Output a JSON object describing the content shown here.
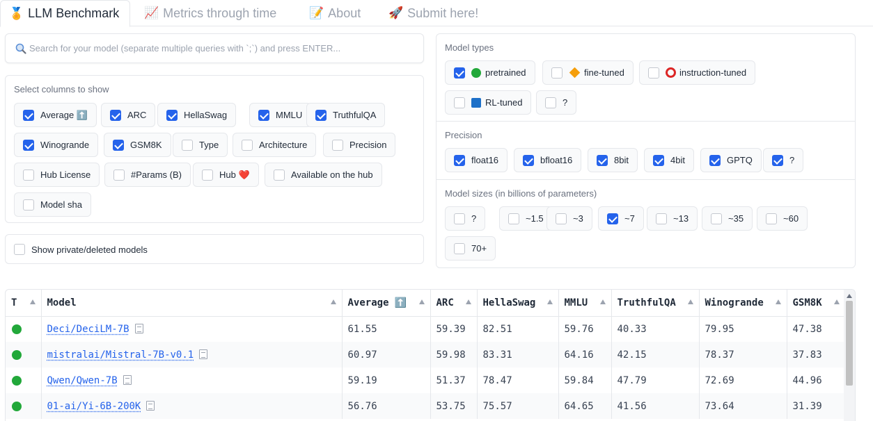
{
  "tabs": [
    {
      "emoji": "🏅",
      "label": "LLM Benchmark"
    },
    {
      "emoji": "📈",
      "label": "Metrics through time"
    },
    {
      "emoji": "📝",
      "label": "About"
    },
    {
      "emoji": "🚀",
      "label": "Submit here!"
    }
  ],
  "search": {
    "placeholder": "Search for your model (separate multiple queries with `;`) and press ENTER..."
  },
  "columns": {
    "label": "Select columns to show",
    "options": [
      {
        "label": "Average ⬆️",
        "checked": true
      },
      {
        "label": "ARC",
        "checked": true
      },
      {
        "label": "HellaSwag",
        "checked": true
      },
      {
        "label": "MMLU",
        "checked": true
      },
      {
        "label": "TruthfulQA",
        "checked": true
      },
      {
        "label": "Winogrande",
        "checked": true
      },
      {
        "label": "GSM8K",
        "checked": true
      },
      {
        "label": "Type",
        "checked": false
      },
      {
        "label": "Architecture",
        "checked": false
      },
      {
        "label": "Precision",
        "checked": false
      },
      {
        "label": "Hub License",
        "checked": false
      },
      {
        "label": "#Params (B)",
        "checked": false
      },
      {
        "label": "Hub ❤️",
        "checked": false
      },
      {
        "label": "Available on the hub",
        "checked": false
      },
      {
        "label": "Model sha",
        "checked": false
      }
    ]
  },
  "private": {
    "label": "Show private/deleted models",
    "checked": false
  },
  "model_types": {
    "label": "Model types",
    "options": [
      {
        "label": "pretrained",
        "checked": true,
        "icon": "green-circle-icon"
      },
      {
        "label": "fine-tuned",
        "checked": false,
        "icon": "orange-diamond-icon"
      },
      {
        "label": "instruction-tuned",
        "checked": false,
        "icon": "red-ring-icon"
      },
      {
        "label": "RL-tuned",
        "checked": false,
        "icon": "blue-square-icon"
      },
      {
        "label": "?",
        "checked": false,
        "icon": ""
      }
    ]
  },
  "precision": {
    "label": "Precision",
    "options": [
      {
        "label": "float16",
        "checked": true
      },
      {
        "label": "bfloat16",
        "checked": true
      },
      {
        "label": "8bit",
        "checked": true
      },
      {
        "label": "4bit",
        "checked": true
      },
      {
        "label": "GPTQ",
        "checked": true
      },
      {
        "label": "?",
        "checked": true
      }
    ]
  },
  "sizes": {
    "label": "Model sizes (in billions of parameters)",
    "options": [
      {
        "label": "?",
        "checked": false
      },
      {
        "label": "~1.5",
        "checked": false
      },
      {
        "label": "~3",
        "checked": false
      },
      {
        "label": "~7",
        "checked": true
      },
      {
        "label": "~13",
        "checked": false
      },
      {
        "label": "~35",
        "checked": false
      },
      {
        "label": "~60",
        "checked": false
      },
      {
        "label": "70+",
        "checked": false
      }
    ]
  },
  "table": {
    "headers": [
      "T",
      "Model",
      "Average ⬆️",
      "ARC",
      "HellaSwag",
      "MMLU",
      "TruthfulQA",
      "Winogrande",
      "GSM8K"
    ],
    "rows": [
      {
        "type": "green-circle-icon",
        "model": "Deci/DeciLM-7B",
        "values": [
          "61.55",
          "59.39",
          "82.51",
          "59.76",
          "40.33",
          "79.95",
          "47.38"
        ]
      },
      {
        "type": "green-circle-icon",
        "model": "mistralai/Mistral-7B-v0.1",
        "values": [
          "60.97",
          "59.98",
          "83.31",
          "64.16",
          "42.15",
          "78.37",
          "37.83"
        ]
      },
      {
        "type": "green-circle-icon",
        "model": "Qwen/Qwen-7B",
        "values": [
          "59.19",
          "51.37",
          "78.47",
          "59.84",
          "47.79",
          "72.69",
          "44.96"
        ]
      },
      {
        "type": "green-circle-icon",
        "model": "01-ai/Yi-6B-200K",
        "values": [
          "56.76",
          "53.75",
          "75.57",
          "64.65",
          "41.56",
          "73.64",
          "31.39"
        ]
      }
    ]
  },
  "colors": {
    "accent": "#2563eb",
    "green": "#22a83a",
    "orange": "#f59e0b",
    "red": "#dc2626",
    "blue": "#1d70c8"
  }
}
